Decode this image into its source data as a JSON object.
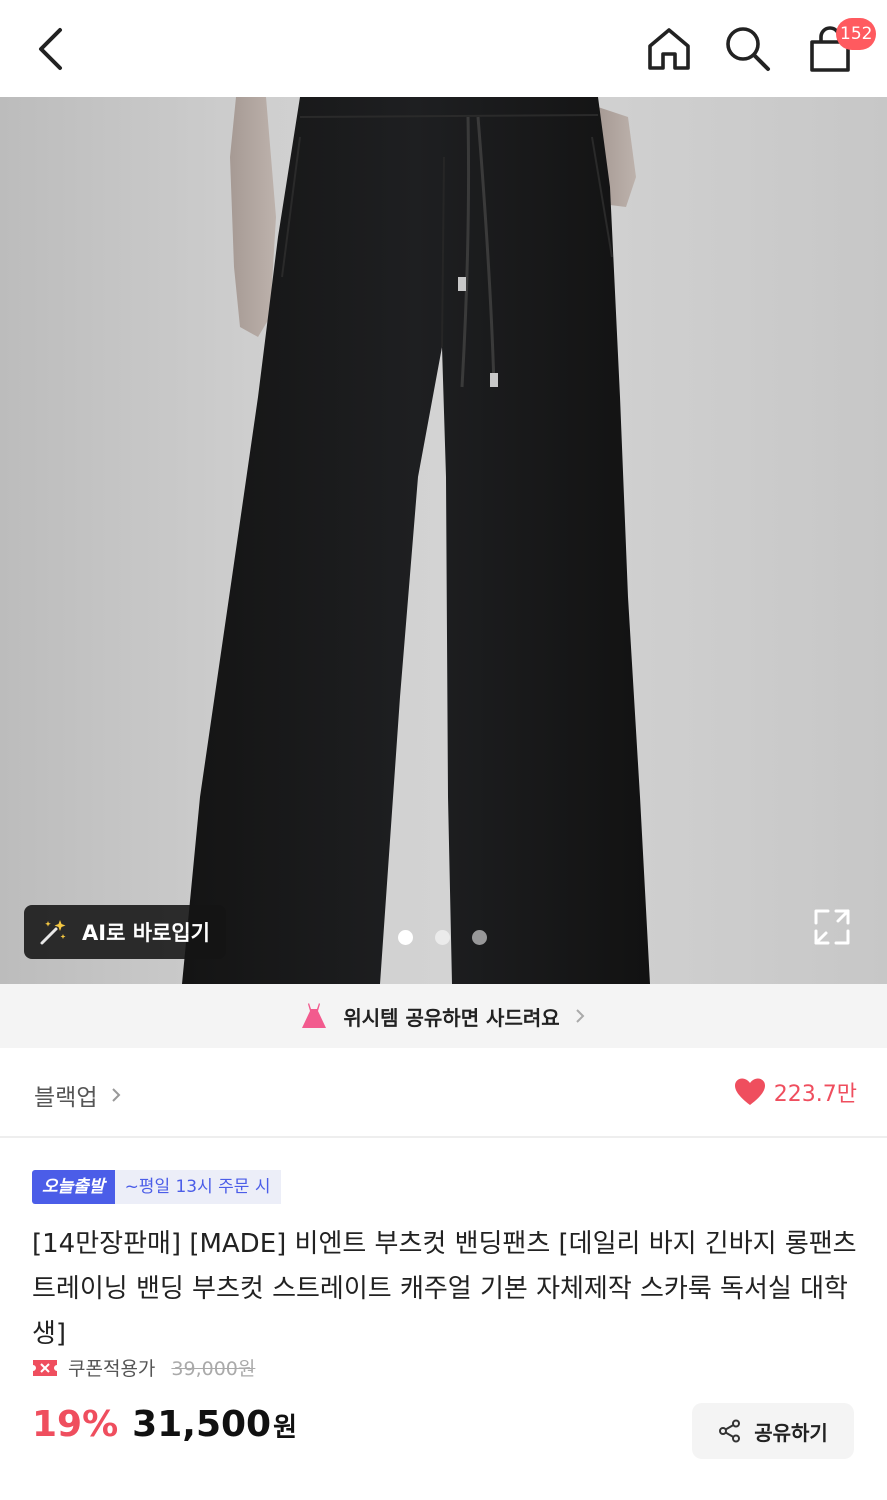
{
  "header": {
    "back_icon": "chevron-left-icon",
    "home_icon": "home-icon",
    "search_icon": "search-icon",
    "cart_icon": "shopping-bag-icon",
    "cart_count": "152"
  },
  "gallery": {
    "ai_try_on_label": "AI로 바로입기",
    "current_index": 1,
    "total_images": 3,
    "expand_icon": "expand-icon"
  },
  "wish_banner": {
    "text": "위시템 공유하면 사드려요"
  },
  "brand_row": {
    "brand": "블랙업",
    "likes": "223.7만"
  },
  "product": {
    "tag_today": "오늘출발",
    "tag_time": "~평일 13시 주문 시",
    "title": "[14만장판매] [MADE] 비엔트 부츠컷 밴딩팬츠 [데일리 바지 긴바지 롱팬츠 트레이닝 밴딩 부츠컷 스트레이트 캐주얼 기본 자체제작 스카룩 독서실 대학생]",
    "coupon_label": "쿠폰적용가",
    "original_price": "39,000원",
    "discount": "19%",
    "price": "31,500",
    "currency": "원",
    "share_label": "공유하기"
  },
  "colors": {
    "accent_red": "#ef4e5e",
    "badge_red": "#ff5a5f",
    "today_blue": "#4b5de8"
  }
}
